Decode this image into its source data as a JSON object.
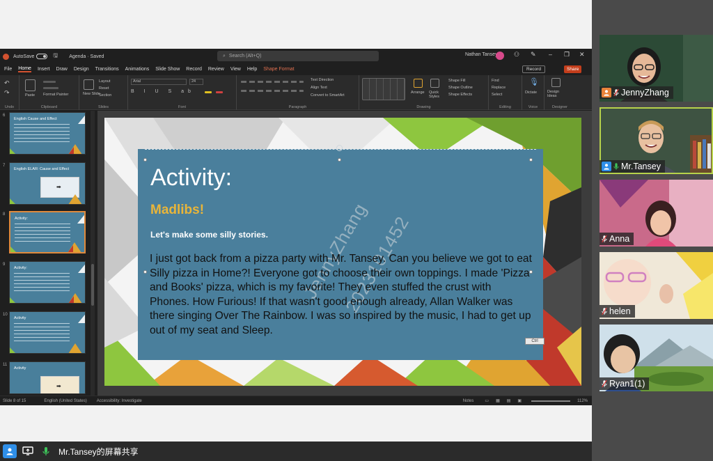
{
  "share_footer": {
    "label": "Mr.Tansey的屏幕共享"
  },
  "ppt": {
    "titlebar": {
      "autosave": "AutoSave",
      "file_name": "Agenda · Saved",
      "search_placeholder": "Search (Alt+Q)",
      "user_name": "Nathan Tansey"
    },
    "menu": [
      "File",
      "Home",
      "Insert",
      "Draw",
      "Design",
      "Transitions",
      "Animations",
      "Slide Show",
      "Record",
      "Review",
      "View",
      "Help",
      "Shape Format"
    ],
    "menu_active": "Home",
    "record_label": "Record",
    "share_label": "Share",
    "ribbon_groups": [
      "Undo",
      "Clipboard",
      "Slides",
      "Font",
      "Paragraph",
      "Drawing",
      "Editing",
      "Voice",
      "Designer"
    ],
    "ribbon_items": {
      "paste": "Paste",
      "format_painter": "Format Painter",
      "new_slide": "New Slide",
      "layout": "Layout",
      "reset": "Reset",
      "section": "Section",
      "font_name": "Arial",
      "font_size": "24",
      "text_direction": "Text Direction",
      "align_text": "Align Text",
      "convert_smartart": "Convert to SmartArt",
      "arrange": "Arrange",
      "quick_styles": "Quick Styles",
      "shape_fill": "Shape Fill",
      "shape_outline": "Shape Outline",
      "shape_effects": "Shape Effects",
      "find": "Find",
      "replace": "Replace",
      "select": "Select",
      "dictate": "Dictate",
      "design_ideas": "Design Ideas"
    },
    "thumb_numbers": [
      "6",
      "7",
      "8",
      "9",
      "10",
      "11"
    ],
    "thumb_titles": [
      "English Cause and Effect",
      "English ELAR: Cause and Effect",
      "Activity:",
      "Activity:",
      "Activity",
      "Activity"
    ],
    "statusbar": {
      "slide_info": "Slide 8 of 15",
      "language": "English (United States)",
      "accessibility": "Accessibility: Investigate",
      "notes": "Notes",
      "zoom": "112%"
    },
    "slide": {
      "title": "Activity:",
      "subtitle": "Madlibs!",
      "tagline": "Let's make some silly stories.",
      "body": "I just got back from a pizza party with Mr. Tansey. Can you believe we got to eat Silly pizza in Home?! Everyone got to choose their own toppings. I made 'Pizza and Books' pizza, which is my favorite! They even stuffed the crust with Phones. How Furious! If that wasn't good enough already, Allan Walker was there singing Over The Rainbow. I was so inspired by the music, I had to get up out of my seat and Sleep.",
      "autofit_label": "Ctrl",
      "watermark": [
        "JennyZhang",
        "2023101452"
      ],
      "colors": {
        "box": "#4a7f9c",
        "subtitle": "#e8b53a"
      }
    }
  },
  "participants": [
    {
      "name": "JennyZhang",
      "speaking": false
    },
    {
      "name": "Mr.Tansey",
      "speaking": true
    },
    {
      "name": "Anna",
      "speaking": false
    },
    {
      "name": "helen",
      "speaking": false
    },
    {
      "name": "Ryan1(1)",
      "speaking": false
    }
  ]
}
